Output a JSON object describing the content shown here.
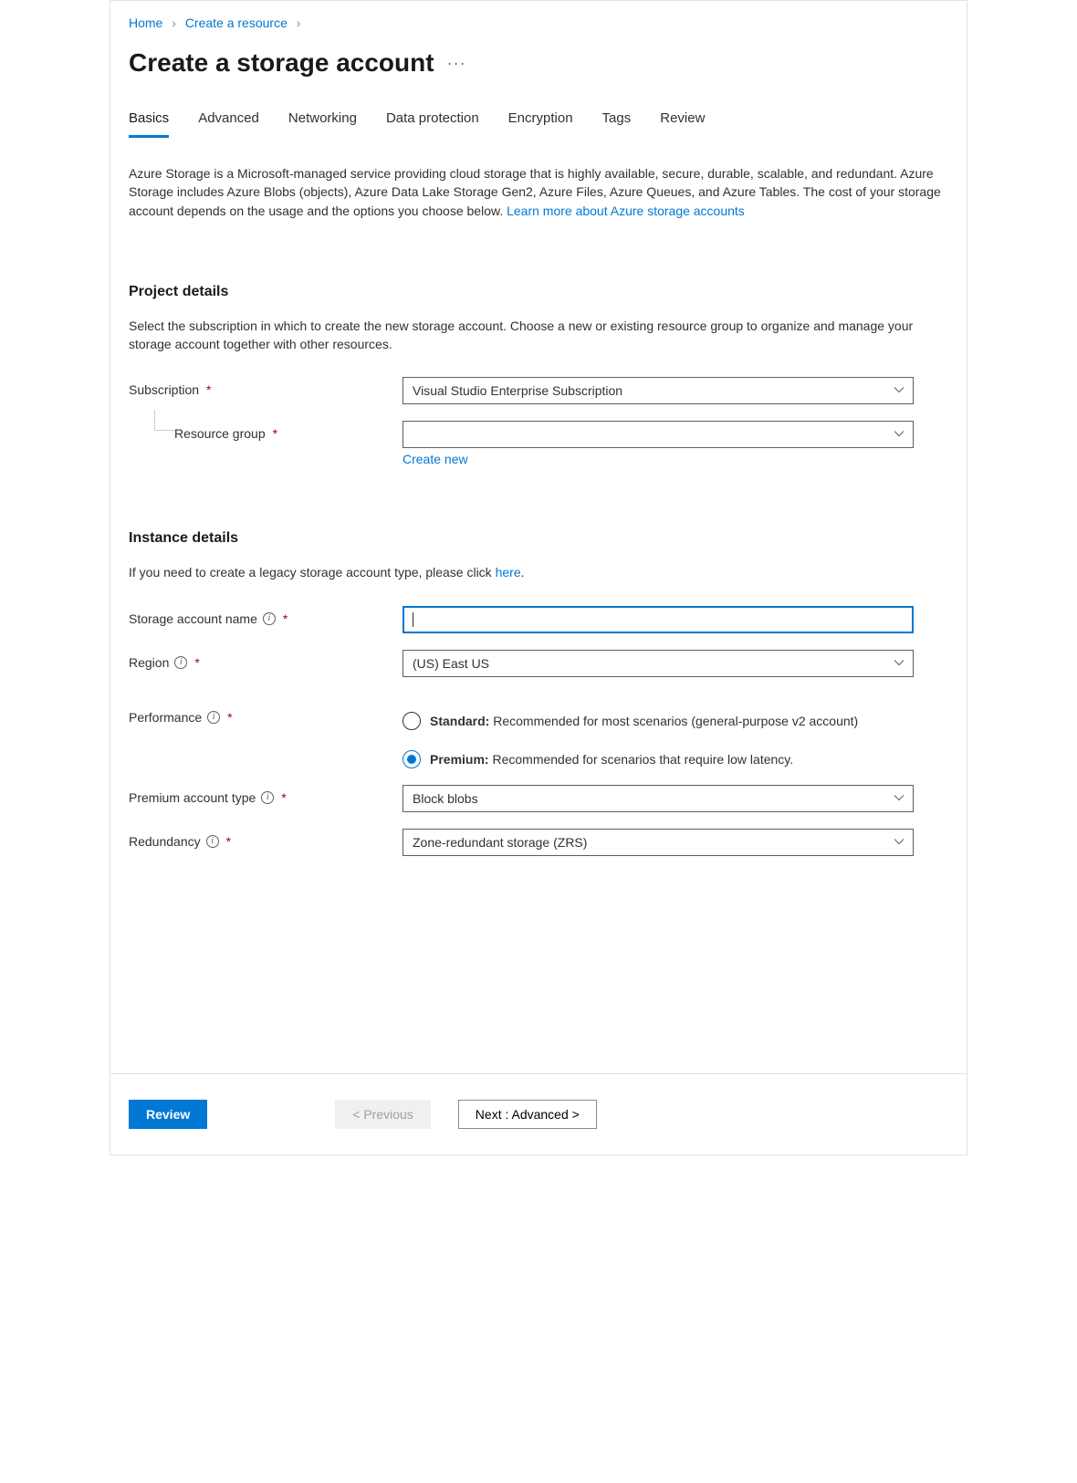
{
  "breadcrumb": {
    "items": [
      {
        "label": "Home"
      },
      {
        "label": "Create a resource"
      }
    ]
  },
  "title": "Create a storage account",
  "tabs": [
    {
      "label": "Basics",
      "active": true
    },
    {
      "label": "Advanced"
    },
    {
      "label": "Networking"
    },
    {
      "label": "Data protection"
    },
    {
      "label": "Encryption"
    },
    {
      "label": "Tags"
    },
    {
      "label": "Review"
    }
  ],
  "intro": {
    "text": "Azure Storage is a Microsoft-managed service providing cloud storage that is highly available, secure, durable, scalable, and redundant. Azure Storage includes Azure Blobs (objects), Azure Data Lake Storage Gen2, Azure Files, Azure Queues, and Azure Tables. The cost of your storage account depends on the usage and the options you choose below. ",
    "link": "Learn more about Azure storage accounts"
  },
  "sections": {
    "project": {
      "heading": "Project details",
      "desc": "Select the subscription in which to create the new storage account. Choose a new or existing resource group to organize and manage your storage account together with other resources.",
      "subscription": {
        "label": "Subscription",
        "value": "Visual Studio Enterprise Subscription"
      },
      "resource_group": {
        "label": "Resource group",
        "value": "",
        "create_new": "Create new"
      }
    },
    "instance": {
      "heading": "Instance details",
      "desc_prefix": "If you need to create a legacy storage account type, please click ",
      "desc_link": "here",
      "desc_suffix": ".",
      "storage_name": {
        "label": "Storage account name",
        "value": ""
      },
      "region": {
        "label": "Region",
        "value": "(US) East US"
      },
      "performance": {
        "label": "Performance",
        "options": [
          {
            "bold": "Standard:",
            "rest": " Recommended for most scenarios (general-purpose v2 account)",
            "checked": false
          },
          {
            "bold": "Premium:",
            "rest": " Recommended for scenarios that require low latency.",
            "checked": true
          }
        ]
      },
      "premium_type": {
        "label": "Premium account type",
        "value": "Block blobs"
      },
      "redundancy": {
        "label": "Redundancy",
        "value": "Zone-redundant storage (ZRS)"
      }
    }
  },
  "footer": {
    "review": "Review",
    "previous": "< Previous",
    "next": "Next : Advanced >"
  }
}
